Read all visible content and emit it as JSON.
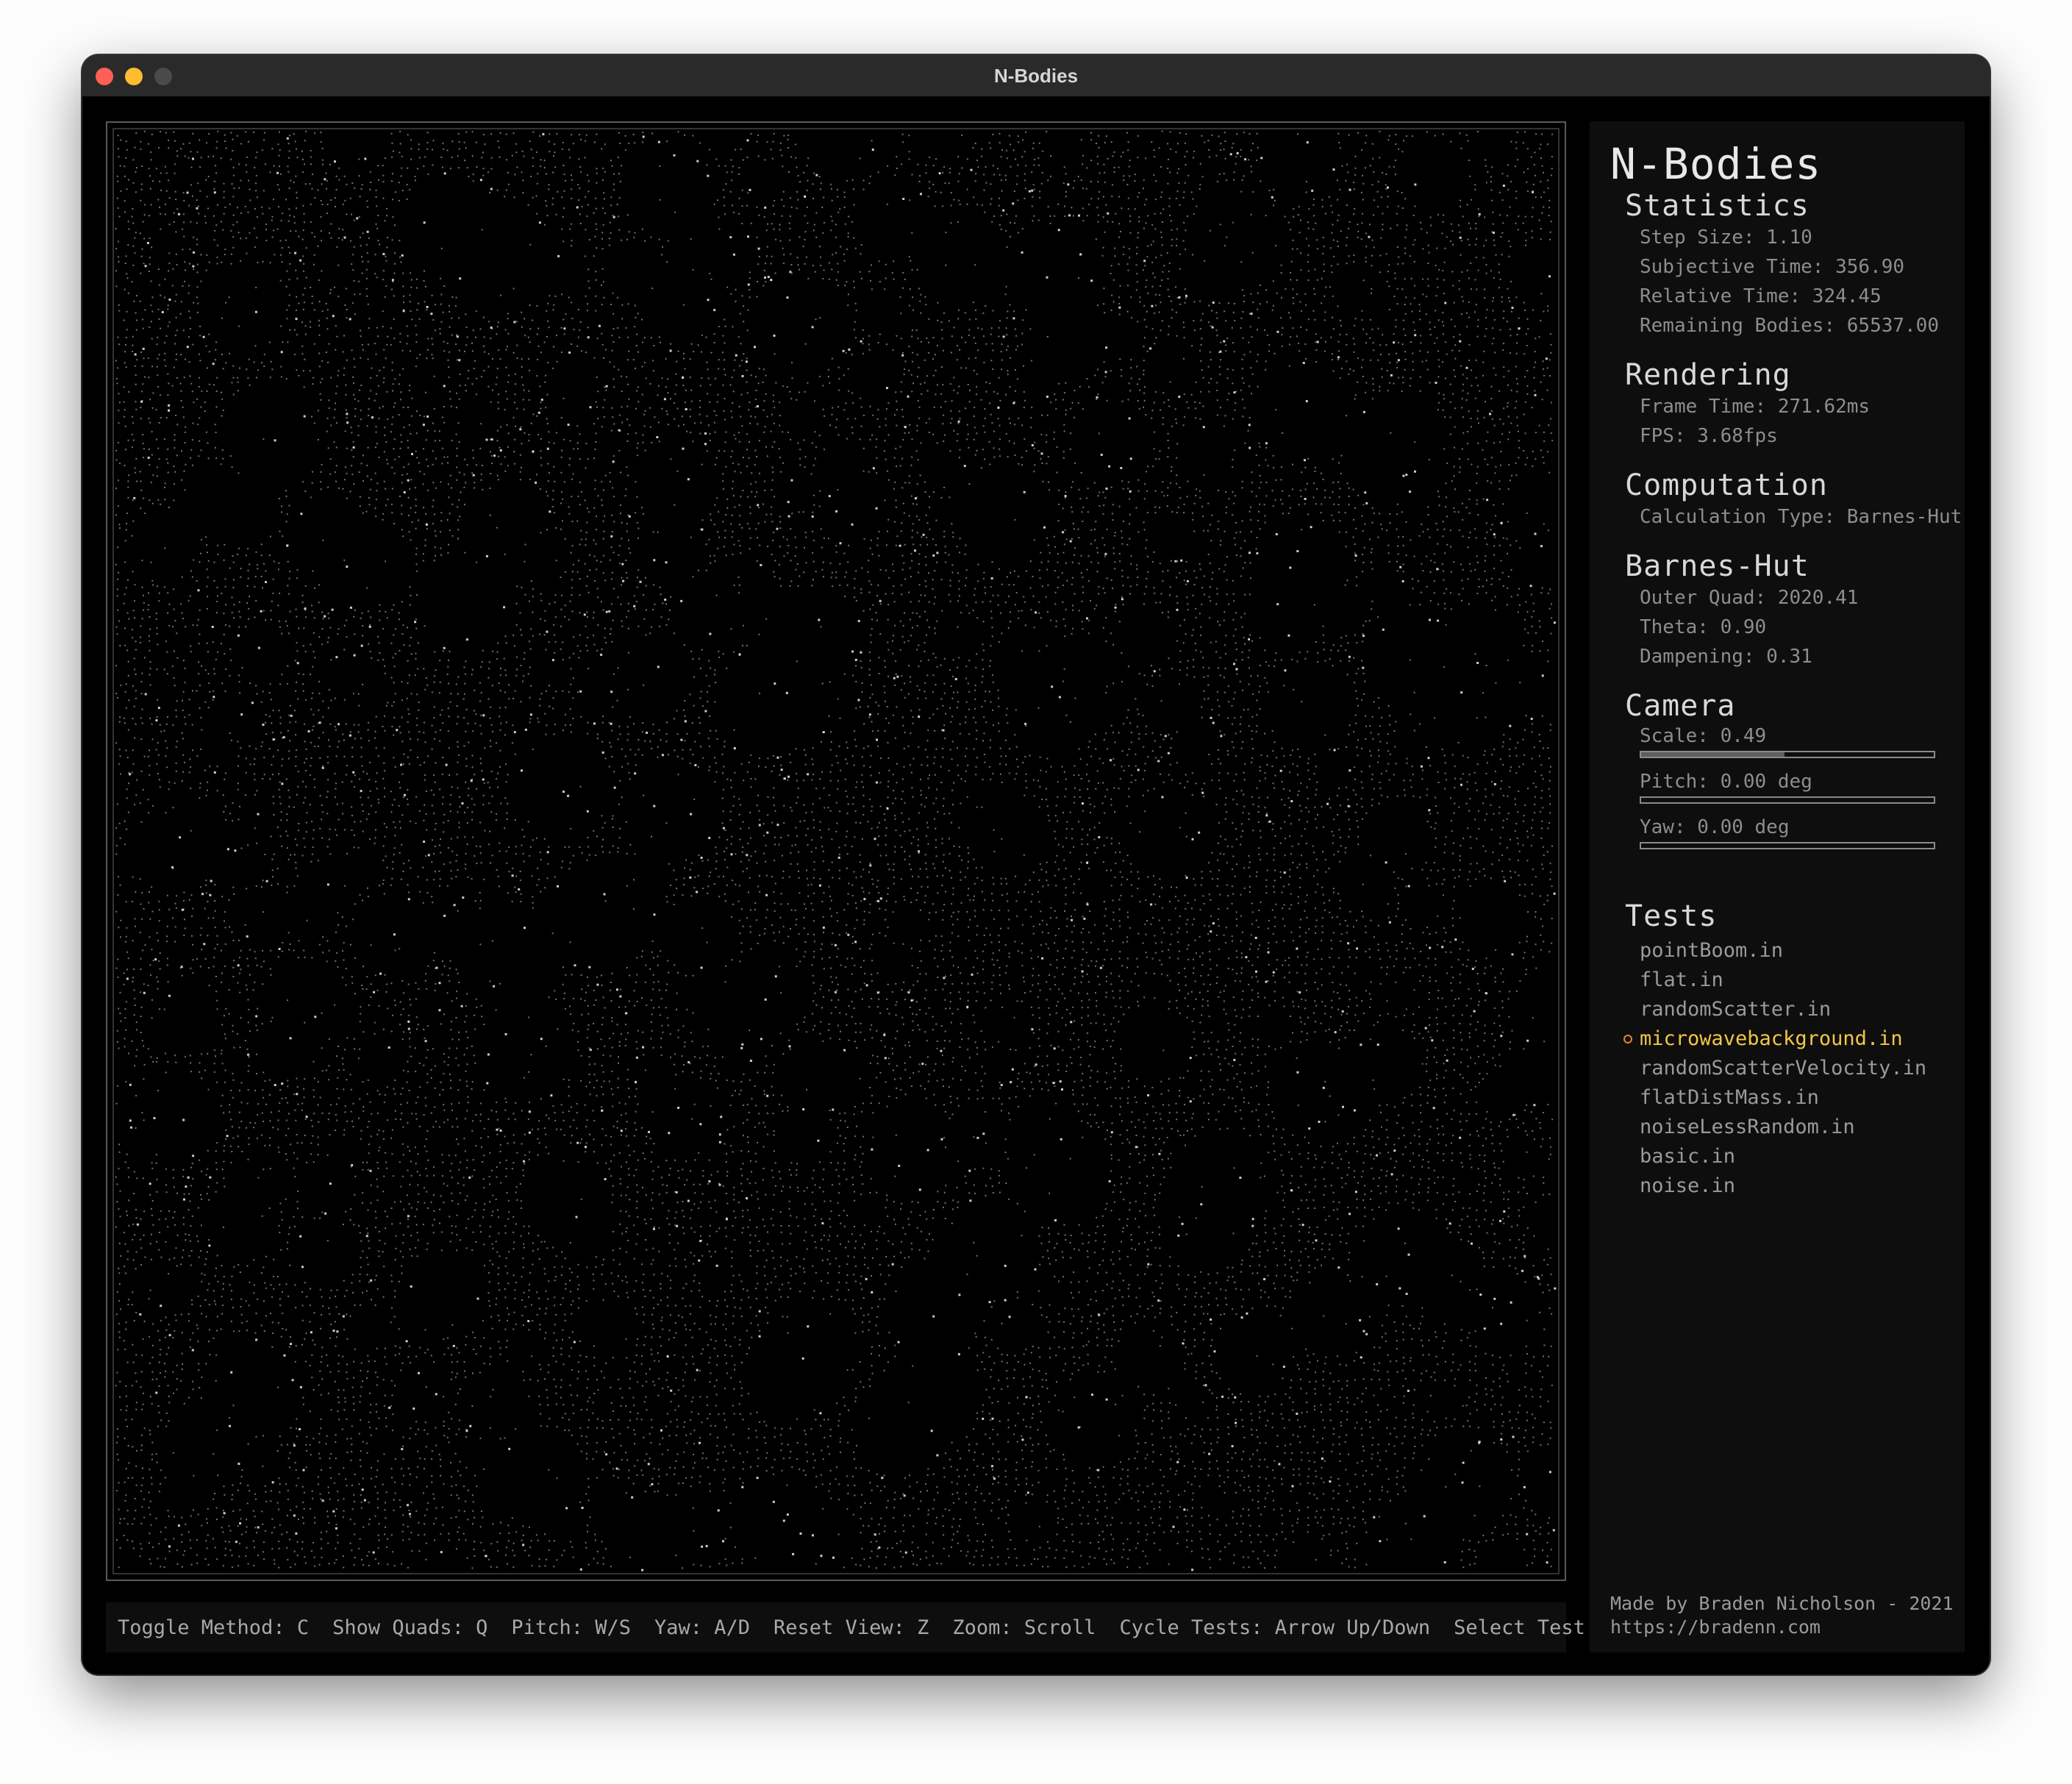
{
  "window": {
    "title": "N-Bodies"
  },
  "simulation": {
    "particle_color": "#d0d0d0",
    "background": "#000000"
  },
  "hotkeys": [
    "Toggle Method: C",
    "Show Quads: Q",
    "Pitch: W/S",
    "Yaw: A/D",
    "Reset View: Z",
    "Zoom: Scroll",
    "Cycle Tests: Arrow Up/Down",
    "Select Test: Enter"
  ],
  "panel": {
    "app_title": "N-Bodies",
    "statistics": {
      "heading": "Statistics",
      "step_size": "Step Size: 1.10",
      "subjective_time": "Subjective Time: 356.90",
      "relative_time": "Relative Time: 324.45",
      "remaining_bodies": "Remaining Bodies: 65537.00"
    },
    "rendering": {
      "heading": "Rendering",
      "frame_time": "Frame Time: 271.62ms",
      "fps": "FPS: 3.68fps"
    },
    "computation": {
      "heading": "Computation",
      "calculation_type": "Calculation Type: Barnes-Hut"
    },
    "barnes_hut": {
      "heading": "Barnes-Hut",
      "outer_quad": "Outer Quad: 2020.41",
      "theta": "Theta: 0.90",
      "dampening": "Dampening: 0.31"
    },
    "camera": {
      "heading": "Camera",
      "scale_label": "Scale: 0.49",
      "scale_value": 0.49,
      "pitch_label": "Pitch: 0.00 deg",
      "pitch_value": 0.0,
      "yaw_label": "Yaw: 0.00 deg",
      "yaw_value": 0.0
    },
    "tests": {
      "heading": "Tests",
      "items": [
        "pointBoom.in",
        "flat.in",
        "randomScatter.in",
        "microwavebackground.in",
        "randomScatterVelocity.in",
        "flatDistMass.in",
        "noiseLessRandom.in",
        "basic.in",
        "noise.in"
      ],
      "selected": "microwavebackground.in",
      "selected_color": "#f2c744"
    },
    "credits": {
      "line1": "Made by Braden Nicholson - 2021",
      "line2": "https://bradenn.com"
    }
  }
}
